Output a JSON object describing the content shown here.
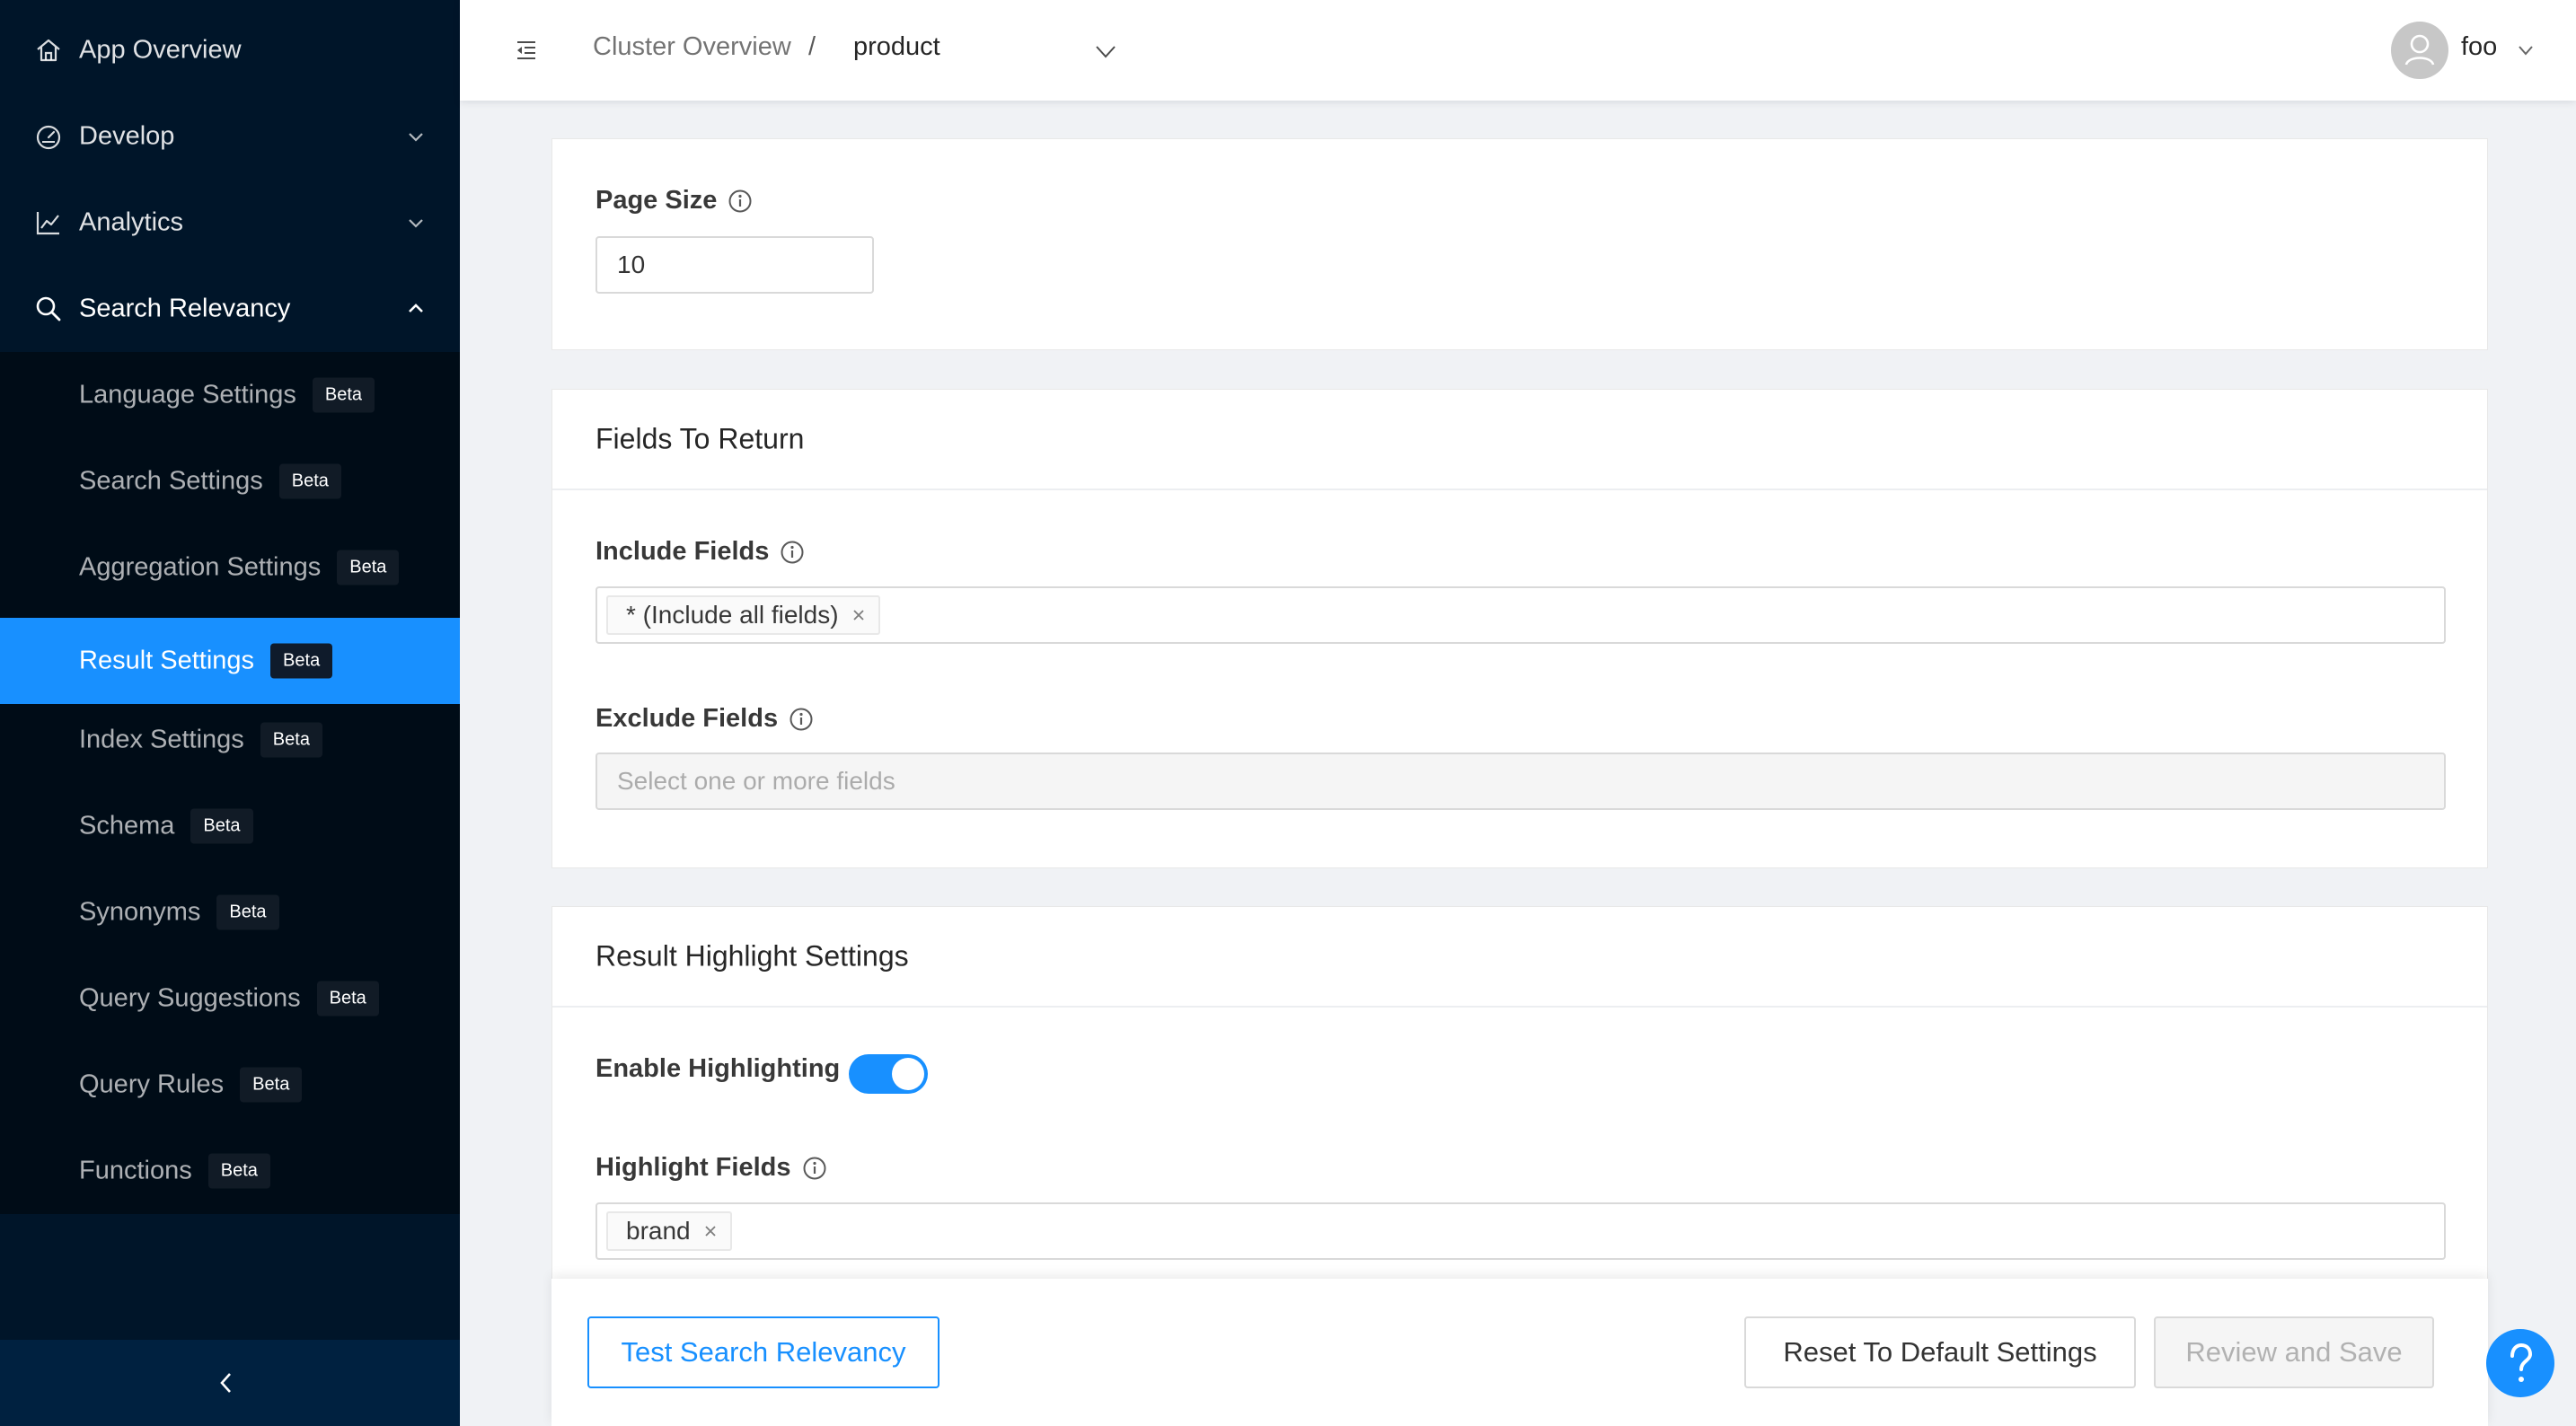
{
  "sidebar": {
    "items": [
      {
        "label": "App Overview",
        "icon": "home-icon"
      },
      {
        "label": "Develop",
        "icon": "dashboard-icon"
      },
      {
        "label": "Analytics",
        "icon": "line-chart-icon"
      },
      {
        "label": "Search Relevancy",
        "icon": "search-icon"
      }
    ],
    "submenu": [
      {
        "label": "Language Settings",
        "badge": "Beta"
      },
      {
        "label": "Search Settings",
        "badge": "Beta"
      },
      {
        "label": "Aggregation Settings",
        "badge": "Beta"
      },
      {
        "label": "Result Settings",
        "badge": "Beta",
        "active": true
      },
      {
        "label": "Index Settings",
        "badge": "Beta"
      },
      {
        "label": "Schema",
        "badge": "Beta"
      },
      {
        "label": "Synonyms",
        "badge": "Beta"
      },
      {
        "label": "Query Suggestions",
        "badge": "Beta"
      },
      {
        "label": "Query Rules",
        "badge": "Beta"
      },
      {
        "label": "Functions",
        "badge": "Beta"
      }
    ]
  },
  "header": {
    "breadcrumb_root": "Cluster Overview",
    "breadcrumb_separator": "/",
    "index_selected": "product",
    "user_name": "foo"
  },
  "page_size": {
    "label": "Page Size",
    "value": "10"
  },
  "fields_to_return": {
    "title": "Fields To Return",
    "include_label": "Include Fields",
    "include_tags": [
      "* (Include all fields)"
    ],
    "exclude_label": "Exclude Fields",
    "exclude_placeholder": "Select one or more fields"
  },
  "highlight": {
    "title": "Result Highlight Settings",
    "enable_label": "Enable Highlighting",
    "enabled": true,
    "fields_label": "Highlight Fields",
    "fields_tags": [
      "brand"
    ]
  },
  "footer": {
    "test_label": "Test Search Relevancy",
    "reset_label": "Reset To Default Settings",
    "save_label": "Review and Save"
  },
  "colors": {
    "sidebar_bg": "#001529",
    "submenu_bg": "#000c17",
    "accent": "#1890ff"
  }
}
